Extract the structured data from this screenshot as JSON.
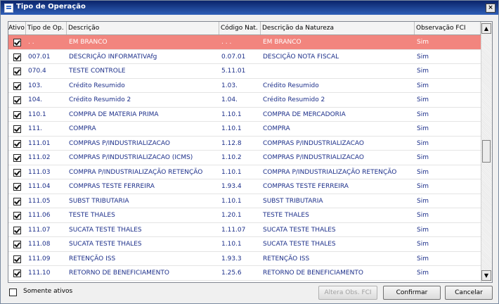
{
  "window": {
    "title": "Tipo de Operação",
    "close_label": "×"
  },
  "grid": {
    "columns": [
      "Ativo",
      "Tipo de Op.",
      "Descrição",
      "Código Nat.",
      "Descrição da Natureza",
      "Observação FCI"
    ],
    "rows": [
      {
        "active": true,
        "tipo": ". .",
        "descricao": "EM BRANCO",
        "codigo": ". . .",
        "natureza": "EM BRANCO",
        "fci": "Sim"
      },
      {
        "active": true,
        "tipo": "007.01",
        "descricao": "DESCRIÇÃO INFORMATIVAfg",
        "codigo": "0.07.01",
        "natureza": "DESCIÇÃO NOTA FISCAL",
        "fci": "Sim"
      },
      {
        "active": true,
        "tipo": "070.4",
        "descricao": "TESTE CONTROLE",
        "codigo": "5.11.01",
        "natureza": "",
        "fci": "Sim"
      },
      {
        "active": true,
        "tipo": "103.",
        "descricao": "Crédito Resumido",
        "codigo": "1.03.",
        "natureza": "Crédito Resumido",
        "fci": "Sim"
      },
      {
        "active": true,
        "tipo": "104.",
        "descricao": "Crédito Resumido 2",
        "codigo": "1.04.",
        "natureza": "Crédito Resumido 2",
        "fci": "Sim"
      },
      {
        "active": true,
        "tipo": "110.1",
        "descricao": "COMPRA DE MATERIA PRIMA",
        "codigo": "1.10.1",
        "natureza": "COMPRA DE MERCADORIA",
        "fci": "Sim"
      },
      {
        "active": true,
        "tipo": "111.",
        "descricao": "COMPRA",
        "codigo": "1.10.1",
        "natureza": "COMPRA",
        "fci": "Sim"
      },
      {
        "active": true,
        "tipo": "111.01",
        "descricao": "COMPRAS P/INDUSTRIALIZACAO",
        "codigo": "1.12.8",
        "natureza": "COMPRAS P/INDUSTRIALIZACAO",
        "fci": "Sim"
      },
      {
        "active": true,
        "tipo": "111.02",
        "descricao": "COMPRAS P/INDUSTRIALIZACAO (ICMS)",
        "codigo": "1.10.2",
        "natureza": "COMPRAS P/INDUSTRIALIZACAO",
        "fci": "Sim"
      },
      {
        "active": true,
        "tipo": "111.03",
        "descricao": "COMPRA P/INDUSTRIALIZAÇÃO RETENÇÃO",
        "codigo": "1.10.1",
        "natureza": "COMPRA P/INDUSTRIALIZAÇÃO RETENÇÃO",
        "fci": "Sim"
      },
      {
        "active": true,
        "tipo": "111.04",
        "descricao": "COMPRAS TESTE FERREIRA",
        "codigo": "1.93.4",
        "natureza": "COMPRAS TESTE FERREIRA",
        "fci": "Sim"
      },
      {
        "active": true,
        "tipo": "111.05",
        "descricao": "SUBST TRIBUTARIA",
        "codigo": "1.10.1",
        "natureza": "SUBST TRIBUTARIA",
        "fci": "Sim"
      },
      {
        "active": true,
        "tipo": "111.06",
        "descricao": "TESTE THALES",
        "codigo": "1.20.1",
        "natureza": "TESTE THALES",
        "fci": "Sim"
      },
      {
        "active": true,
        "tipo": "111.07",
        "descricao": "SUCATA TESTE THALES",
        "codigo": "1.11.07",
        "natureza": "SUCATA TESTE THALES",
        "fci": "Sim"
      },
      {
        "active": true,
        "tipo": "111.08",
        "descricao": "SUCATA TESTE THALES",
        "codigo": "1.10.1",
        "natureza": "SUCATA TESTE THALES",
        "fci": "Sim"
      },
      {
        "active": true,
        "tipo": "111.09",
        "descricao": "RETENÇÃO ISS",
        "codigo": "1.93.3",
        "natureza": "RETENÇÃO ISS",
        "fci": "Sim"
      },
      {
        "active": true,
        "tipo": "111.10",
        "descricao": "RETORNO DE BENEFICIAMENTO",
        "codigo": "1.25.6",
        "natureza": "RETORNO DE BENEFICIAMENTO",
        "fci": "Sim"
      }
    ]
  },
  "footer": {
    "only_active_label": "Somente ativos",
    "btn_alterar": "Altera Obs. FCI",
    "btn_confirmar": "Confirmar",
    "btn_cancelar": "Cancelar"
  }
}
